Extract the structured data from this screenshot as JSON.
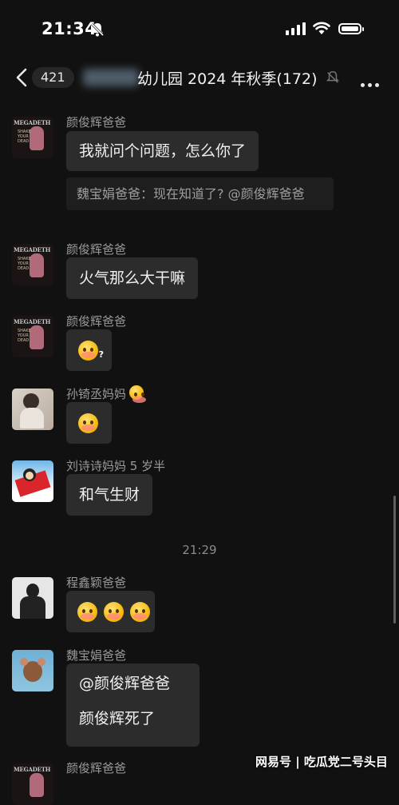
{
  "status": {
    "time": "21:34"
  },
  "header": {
    "back_count": "421",
    "title": "幼儿园 2024 年秋季(172)"
  },
  "messages": [
    {
      "sender": "颜俊辉爸爸",
      "text": "我就问个问题，怎么你了",
      "quote": "魏宝娟爸爸：现在知道了? @颜俊辉爸爸"
    },
    {
      "sender": "颜俊辉爸爸",
      "text": "火气那么大干嘛"
    },
    {
      "sender": "颜俊辉爸爸",
      "emoji": "thinking-face-emoji"
    },
    {
      "sender": "孙锜丞妈妈",
      "emoji": "blushing-face-emoji"
    },
    {
      "sender": "刘诗诗妈妈 5 岁半",
      "text": "和气生财"
    },
    {
      "time": "21:29"
    },
    {
      "sender": "程鑫颖爸爸",
      "emoji": "blushing-face-emoji x3"
    },
    {
      "sender": "魏宝娟爸爸",
      "line1": "@颜俊辉爸爸",
      "line2": "颜俊辉死了"
    },
    {
      "sender": "颜俊辉爸爸"
    }
  ],
  "avatar_logo": "MEGADETH",
  "watermark": "网易号 | 吃瓜党二号头目",
  "colors": {
    "background": "#111111",
    "bubble": "#2c2c2c",
    "quote": "#1e1e1e"
  }
}
